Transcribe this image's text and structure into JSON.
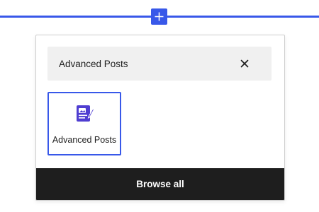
{
  "colors": {
    "accent": "#3858e9",
    "search_bg": "#f0f0f0",
    "footer_bg": "#1e1e1e",
    "block_icon": "#4f3ed1"
  },
  "inserter_toggle": {
    "icon": "plus-icon"
  },
  "search": {
    "value": "Advanced Posts",
    "clear_icon": "close-icon"
  },
  "results": [
    {
      "label": "Advanced Posts",
      "icon": "advanced-posts-icon",
      "selected": true
    }
  ],
  "footer": {
    "browse_all_label": "Browse all"
  }
}
